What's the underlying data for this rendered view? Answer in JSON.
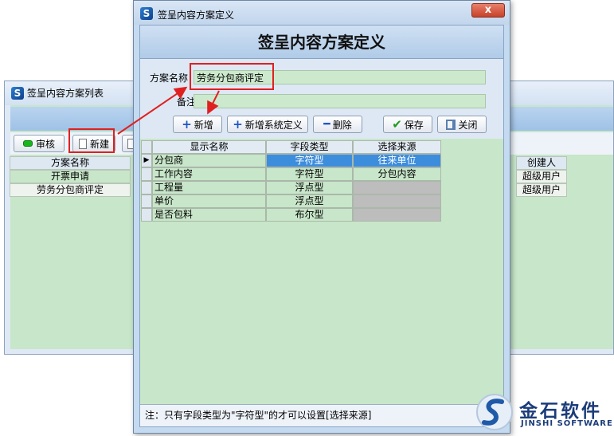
{
  "background_window": {
    "title": "签呈内容方案列表",
    "toolbar": {
      "review_label": "审核",
      "new_label": "新建"
    },
    "table": {
      "headers": {
        "scheme_name": "方案名称",
        "creator": "创建人"
      },
      "rows": [
        {
          "scheme_name": "开票申请",
          "creator": "超级用户"
        },
        {
          "scheme_name": "劳务分包商评定",
          "creator": "超级用户"
        }
      ]
    }
  },
  "dialog": {
    "title": "签呈内容方案定义",
    "close_glyph": "x",
    "header": "签呈内容方案定义",
    "form": {
      "scheme_name_label": "方案名称",
      "scheme_name_value": "劳务分包商评定",
      "remark_label": "备注",
      "remark_value": ""
    },
    "toolbar": {
      "add_label": "新增",
      "add_system_label": "新增系统定义",
      "delete_label": "删除",
      "save_label": "保存",
      "close_label": "关闭"
    },
    "grid": {
      "headers": {
        "display_name": "显示名称",
        "field_type": "字段类型",
        "source": "选择来源"
      },
      "rows": [
        {
          "display_name": "分包商",
          "field_type": "字符型",
          "source": "往来单位"
        },
        {
          "display_name": "工作内容",
          "field_type": "字符型",
          "source": "分包内容"
        },
        {
          "display_name": "工程量",
          "field_type": "浮点型",
          "source": ""
        },
        {
          "display_name": "单价",
          "field_type": "浮点型",
          "source": ""
        },
        {
          "display_name": "是否包料",
          "field_type": "布尔型",
          "source": ""
        }
      ]
    },
    "note": "注：只有字段类型为\"字符型\"的才可以设置[选择来源]"
  },
  "watermark": {
    "brand_cn": "金石软件",
    "brand_en": "JINSHI SOFTWARE"
  },
  "colors": {
    "grid_green": "#c8e6c9",
    "selection_blue": "#3d8ddd",
    "highlight_red": "#e02020",
    "disabled_gray": "#bdbdbd"
  }
}
